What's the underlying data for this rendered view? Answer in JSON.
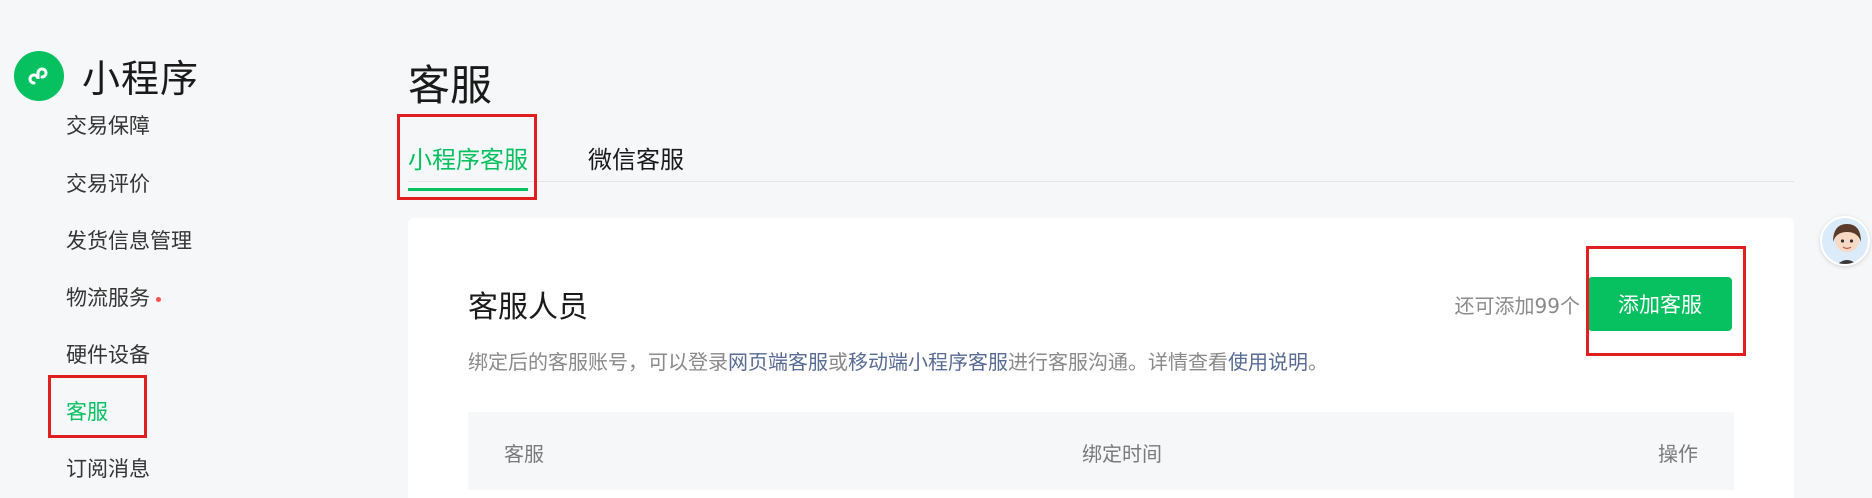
{
  "app": {
    "name": "小程序"
  },
  "sidebar": {
    "items": [
      {
        "label": "交易保障"
      },
      {
        "label": "交易评价"
      },
      {
        "label": "发货信息管理"
      },
      {
        "label": "物流服务"
      },
      {
        "label": "硬件设备"
      },
      {
        "label": "客服"
      },
      {
        "label": "订阅消息"
      }
    ]
  },
  "page": {
    "title": "客服",
    "tabs": [
      {
        "label": "小程序客服"
      },
      {
        "label": "微信客服"
      }
    ]
  },
  "section": {
    "title": "客服人员",
    "remain_text": "还可添加99个",
    "add_button": "添加客服",
    "desc_prefix": "绑定后的客服账号，可以登录",
    "link_web": "网页端客服",
    "desc_or": "或",
    "link_mobile": "移动端小程序客服",
    "desc_mid": "进行客服沟通。详情查看",
    "link_help": "使用说明",
    "desc_end": "。"
  },
  "table": {
    "columns": [
      "客服",
      "绑定时间",
      "操作"
    ]
  },
  "colors": {
    "accent": "#07c160",
    "link": "#576b95",
    "annotation": "#e02020"
  }
}
